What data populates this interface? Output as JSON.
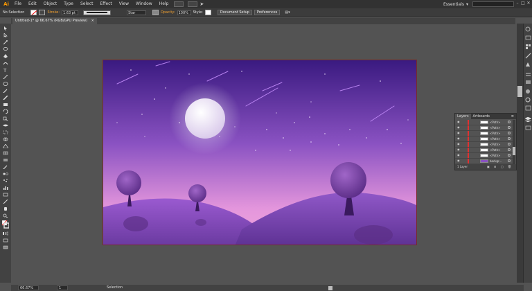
{
  "app": {
    "logo": "Ai"
  },
  "menu": [
    "File",
    "Edit",
    "Object",
    "Type",
    "Select",
    "Effect",
    "View",
    "Window",
    "Help"
  ],
  "workspace": "Essentials",
  "control_bar": {
    "selection": "No Selection",
    "stroke_label": "Stroke:",
    "stroke_weight": "1.63 pt",
    "brush": "Star",
    "opacity_label": "Opacity:",
    "opacity_value": "100%",
    "style_label": "Style:",
    "doc_setup": "Document Setup",
    "preferences": "Preferences"
  },
  "document_tab": "Untitled-1* @ 66.67% (RGB/GPU Preview)",
  "layers_panel": {
    "tabs": [
      "Layers",
      "Artboards"
    ],
    "rows": [
      {
        "name": "<Path>"
      },
      {
        "name": "<Path>"
      },
      {
        "name": "<Path>"
      },
      {
        "name": "<Path>"
      },
      {
        "name": "<Path>"
      },
      {
        "name": "<Path>"
      },
      {
        "name": "<Path>"
      },
      {
        "name": "backgr..."
      }
    ],
    "footer": "1 Layer"
  },
  "status": {
    "zoom": "66.67%",
    "page": "1",
    "tool": "Selection"
  },
  "colors": {
    "sky_top": "#3a1a80",
    "sky_mid": "#9a5cc8",
    "sky_bottom": "#e89ae0",
    "hill": "#8a4cc0",
    "accent": "#ff9a00"
  }
}
